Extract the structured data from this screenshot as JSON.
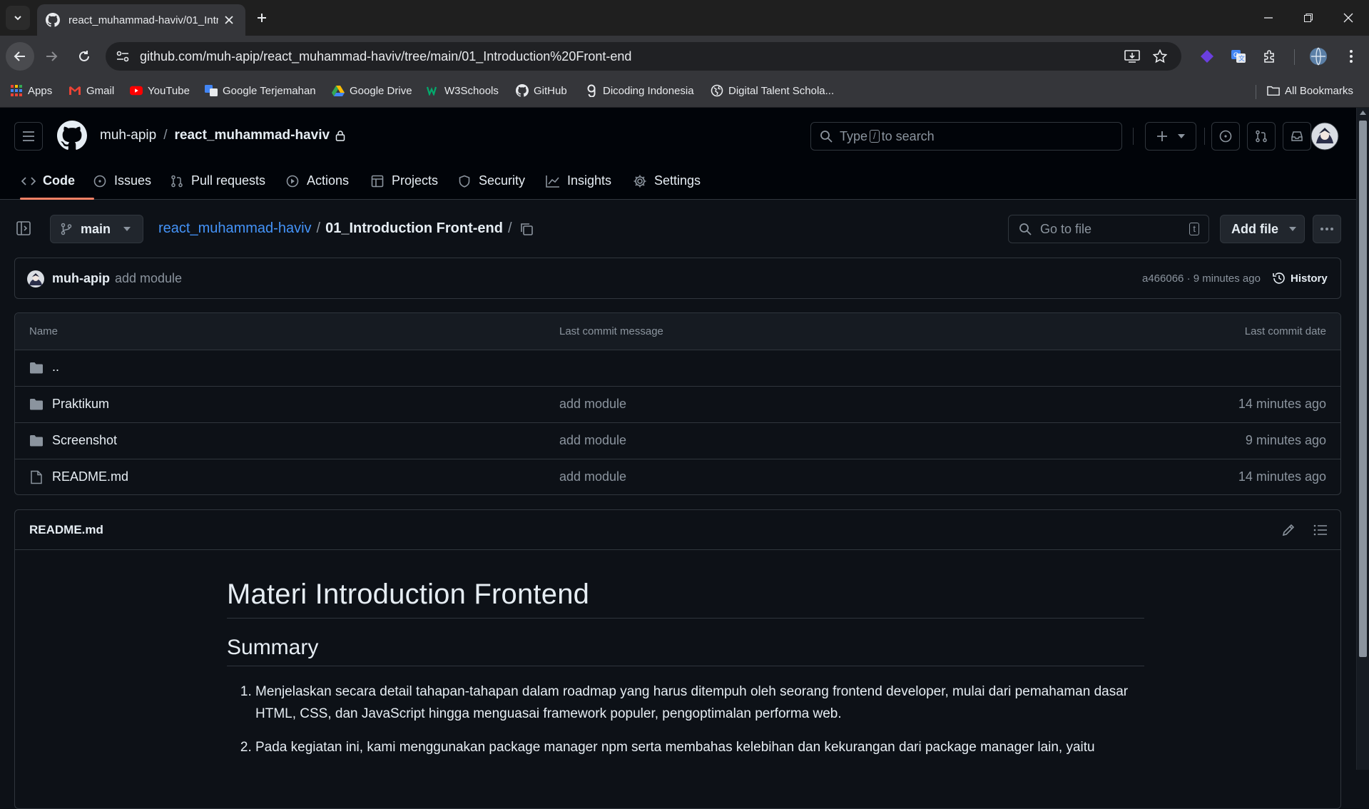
{
  "browser": {
    "tab_title": "react_muhammad-haviv/01_Intr",
    "url": "github.com/muh-apip/react_muhammad-haviv/tree/main/01_Introduction%20Front-end",
    "bookmarks": [
      {
        "label": "Apps",
        "icon": "apps-grid-icon"
      },
      {
        "label": "Gmail",
        "icon": "gmail-icon"
      },
      {
        "label": "YouTube",
        "icon": "youtube-icon"
      },
      {
        "label": "Google Terjemahan",
        "icon": "google-translate-icon"
      },
      {
        "label": "Google Drive",
        "icon": "google-drive-icon"
      },
      {
        "label": "W3Schools",
        "icon": "w3schools-icon"
      },
      {
        "label": "GitHub",
        "icon": "github-icon"
      },
      {
        "label": "Dicoding Indonesia",
        "icon": "dicoding-icon"
      },
      {
        "label": "Digital Talent Schola...",
        "icon": "globe-icon"
      }
    ],
    "all_bookmarks": "All Bookmarks"
  },
  "github": {
    "owner": "muh-apip",
    "separator": "/",
    "repo": "react_muhammad-haviv",
    "search_prefix": "Type",
    "search_key": "/",
    "search_suffix": "to search",
    "tabs": [
      {
        "label": "Code",
        "icon": "code-icon"
      },
      {
        "label": "Issues",
        "icon": "issue-icon"
      },
      {
        "label": "Pull requests",
        "icon": "pull-request-icon"
      },
      {
        "label": "Actions",
        "icon": "play-icon"
      },
      {
        "label": "Projects",
        "icon": "table-icon"
      },
      {
        "label": "Security",
        "icon": "shield-icon"
      },
      {
        "label": "Insights",
        "icon": "graph-icon"
      },
      {
        "label": "Settings",
        "icon": "gear-icon"
      }
    ]
  },
  "path_bar": {
    "branch": "main",
    "repo_link": "react_muhammad-haviv",
    "sep": "/",
    "folder": "01_Introduction Front-end",
    "trailing_sep": "/",
    "goto_placeholder": "Go to file",
    "goto_key": "t",
    "add_file": "Add file"
  },
  "commit": {
    "author": "muh-apip",
    "message": "add module",
    "hash_time": "a466066 · 9 minutes ago",
    "history": "History"
  },
  "files": {
    "headers": {
      "name": "Name",
      "message": "Last commit message",
      "date": "Last commit date"
    },
    "parent": "..",
    "rows": [
      {
        "name": "Praktikum",
        "type": "folder",
        "message": "add module",
        "date": "14 minutes ago"
      },
      {
        "name": "Screenshot",
        "type": "folder",
        "message": "add module",
        "date": "9 minutes ago"
      },
      {
        "name": "README.md",
        "type": "file",
        "message": "add module",
        "date": "14 minutes ago"
      }
    ]
  },
  "readme": {
    "filename": "README.md",
    "h1": "Materi Introduction Frontend",
    "h2": "Summary",
    "items": [
      "Menjelaskan secara detail tahapan-tahapan dalam roadmap yang harus ditempuh oleh seorang frontend developer, mulai dari pemahaman dasar HTML, CSS, dan JavaScript hingga menguasai framework populer, pengoptimalan performa web.",
      "Pada kegiatan ini, kami menggunakan package manager npm serta membahas kelebihan dan kekurangan dari package manager lain, yaitu"
    ]
  },
  "colors": {
    "link": "#4493f8",
    "accent": "#f78166",
    "muted": "#8b949e"
  }
}
